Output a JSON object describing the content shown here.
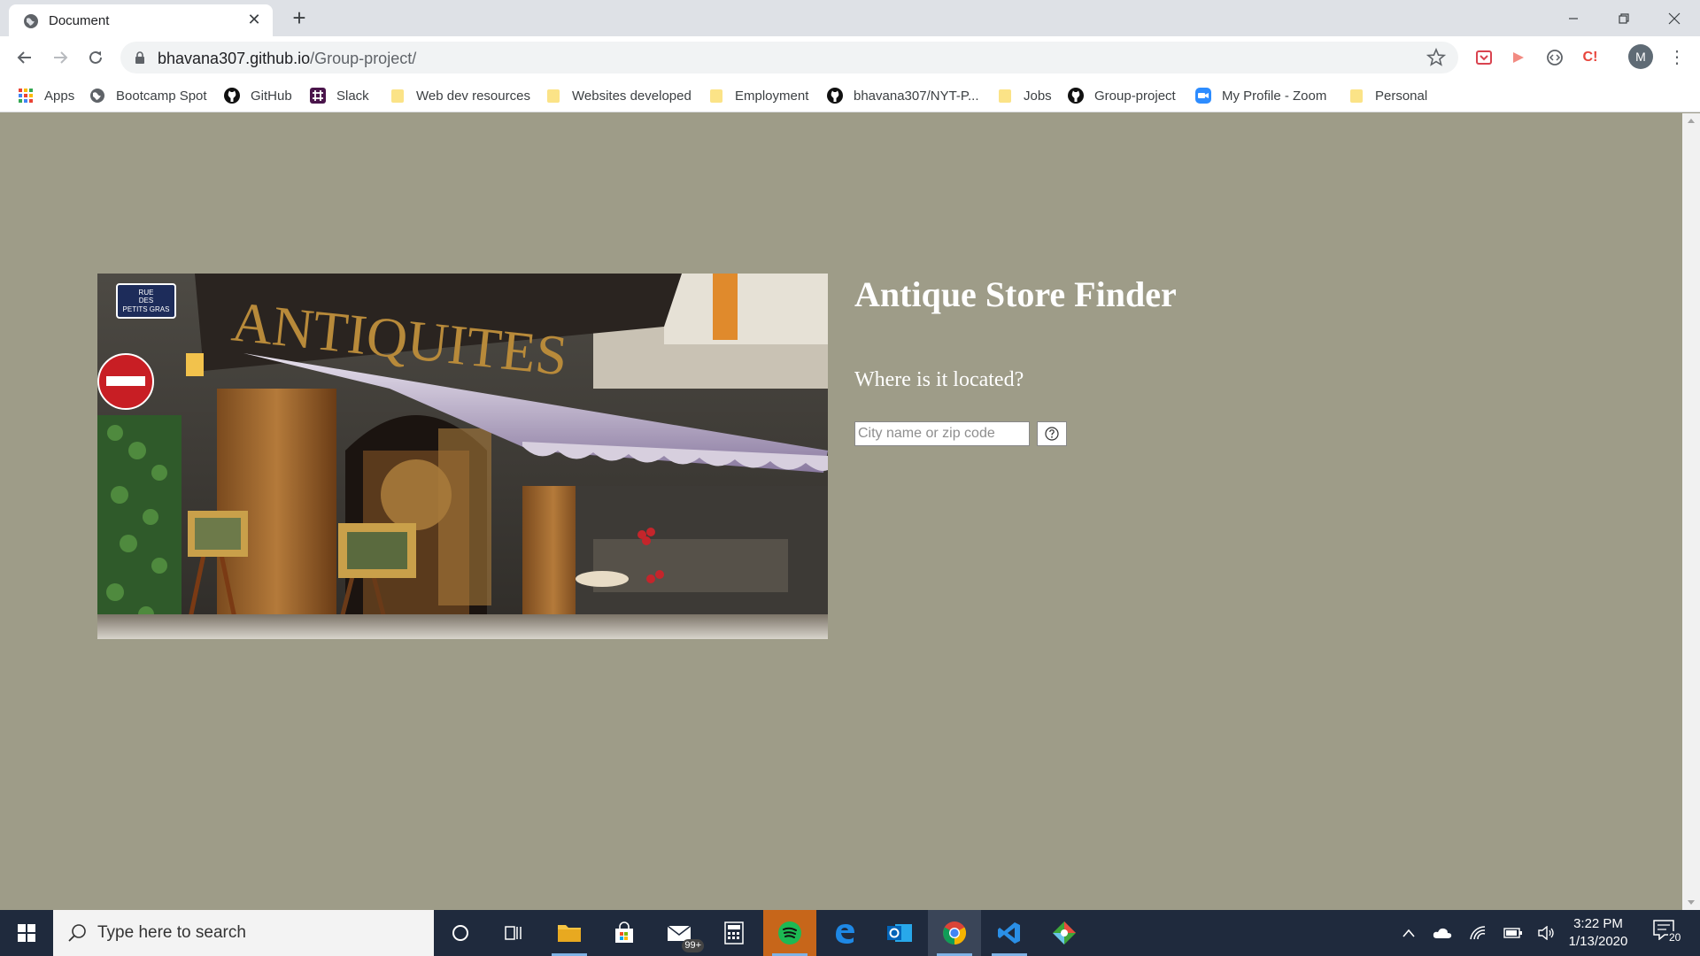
{
  "browser": {
    "tab_title": "Document",
    "tab_close": "✕",
    "new_tab": "+",
    "url_host": "bhavana307.github.io",
    "url_path": "/Group-project/",
    "avatar_letter": "M",
    "menu": "⋮"
  },
  "bookmarks": [
    {
      "label": "Apps",
      "icon": "apps-grid-icon"
    },
    {
      "label": "Bootcamp Spot",
      "icon": "globe-icon"
    },
    {
      "label": "GitHub",
      "icon": "github-icon"
    },
    {
      "label": "Slack",
      "icon": "slack-icon"
    },
    {
      "label": "Web dev resources",
      "icon": "folder-icon"
    },
    {
      "label": "Websites developed",
      "icon": "folder-icon"
    },
    {
      "label": "Employment",
      "icon": "folder-icon"
    },
    {
      "label": "bhavana307/NYT-P...",
      "icon": "github-icon"
    },
    {
      "label": "Jobs",
      "icon": "folder-icon"
    },
    {
      "label": "Group-project",
      "icon": "github-icon"
    },
    {
      "label": "My Profile - Zoom",
      "icon": "zoom-icon"
    },
    {
      "label": "Personal",
      "icon": "folder-icon"
    }
  ],
  "page": {
    "title": "Antique Store Finder",
    "subtitle": "Where is it located?",
    "search_placeholder": "City name or zip code",
    "search_value": "",
    "image_sign_text": "ANTIQUITES",
    "street_sign_lines": [
      "RUE",
      "DES",
      "PETITS GRAS"
    ],
    "background_color": "#9e9c88"
  },
  "taskbar": {
    "search_placeholder": "Type here to search",
    "time": "3:22 PM",
    "date": "1/13/2020",
    "notification_count": "20",
    "mail_badge": "99+"
  }
}
